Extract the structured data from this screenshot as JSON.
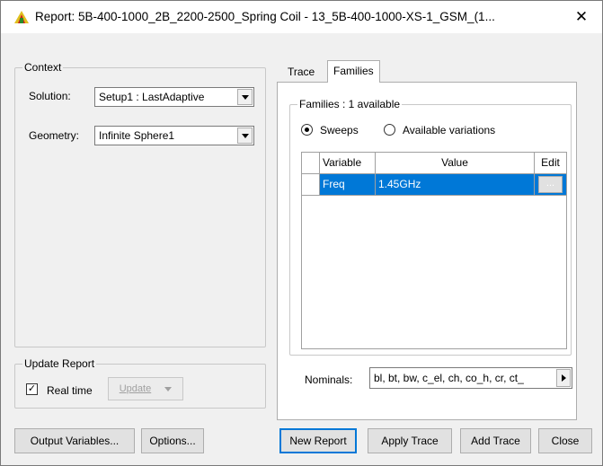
{
  "window": {
    "title": "Report: 5B-400-1000_2B_2200-2500_Spring Coil - 13_5B-400-1000-XS-1_GSM_(1...",
    "close_glyph": "✕"
  },
  "context": {
    "group_label": "Context",
    "solution_label": "Solution:",
    "solution_value": "Setup1 : LastAdaptive",
    "geometry_label": "Geometry:",
    "geometry_value": "Infinite Sphere1"
  },
  "update_report": {
    "group_label": "Update Report",
    "realtime_label": "Real time",
    "realtime_checked": "✓",
    "update_button": "Update"
  },
  "tabs": [
    {
      "label": "Trace"
    },
    {
      "label": "Families"
    }
  ],
  "families": {
    "group_label": "Families : 1 available",
    "radio_sweeps": "Sweeps",
    "radio_variations": "Available variations",
    "table": {
      "headers": [
        "Variable",
        "Value",
        "Edit"
      ],
      "rows": [
        {
          "variable": "Freq",
          "value": "1.45GHz",
          "edit": "..."
        }
      ]
    },
    "nominals_label": "Nominals:",
    "nominals_value": "bl, bt, bw, c_el, ch, co_h, cr, ct_"
  },
  "buttons": {
    "output_variables": "Output Variables...",
    "options": "Options...",
    "new_report": "New Report",
    "apply_trace": "Apply Trace",
    "add_trace": "Add Trace",
    "close": "Close"
  },
  "colors": {
    "selection": "#0078d7",
    "window_bg": "#f0f0f0"
  }
}
